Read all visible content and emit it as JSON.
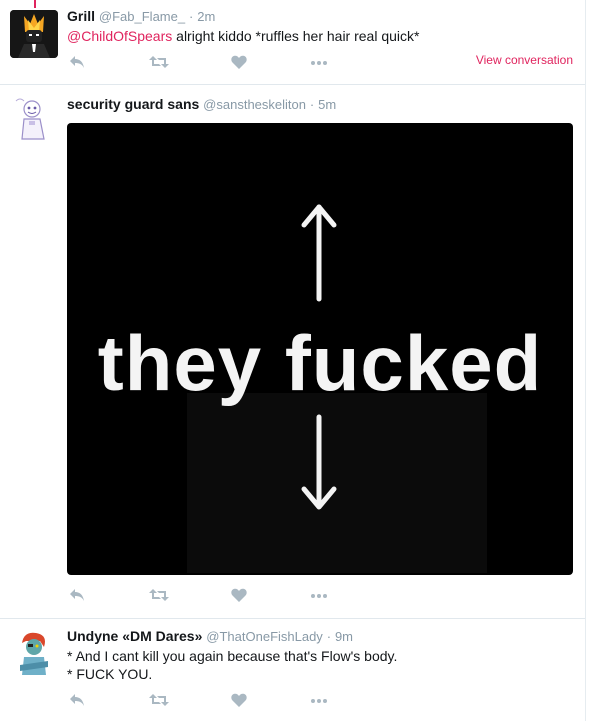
{
  "tweets": [
    {
      "name": "Grill",
      "handle": "@Fab_Flame_",
      "separator": "·",
      "time": "2m",
      "mention": "@ChildOfSpears",
      "text": " alright kiddo *ruffles her hair real quick*",
      "view_conversation": "View conversation"
    },
    {
      "name": "security guard sans",
      "handle": "@sanstheskeliton",
      "separator": "·",
      "time": "5m",
      "media_text": "they fucked"
    },
    {
      "name": "Undyne «DM Dares»",
      "handle": "@ThatOneFishLady",
      "separator": "·",
      "time": "9m",
      "line1": "* And I cant kill you again because that's Flow's body.",
      "line2": "* FUCK YOU."
    }
  ],
  "colors": {
    "accent": "#e0245e",
    "muted": "#8899a6",
    "action_icons": "#aab8c2",
    "divider": "#e1e8ed"
  },
  "icons": [
    "reply-icon",
    "retweet-icon",
    "like-icon",
    "more-icon"
  ]
}
